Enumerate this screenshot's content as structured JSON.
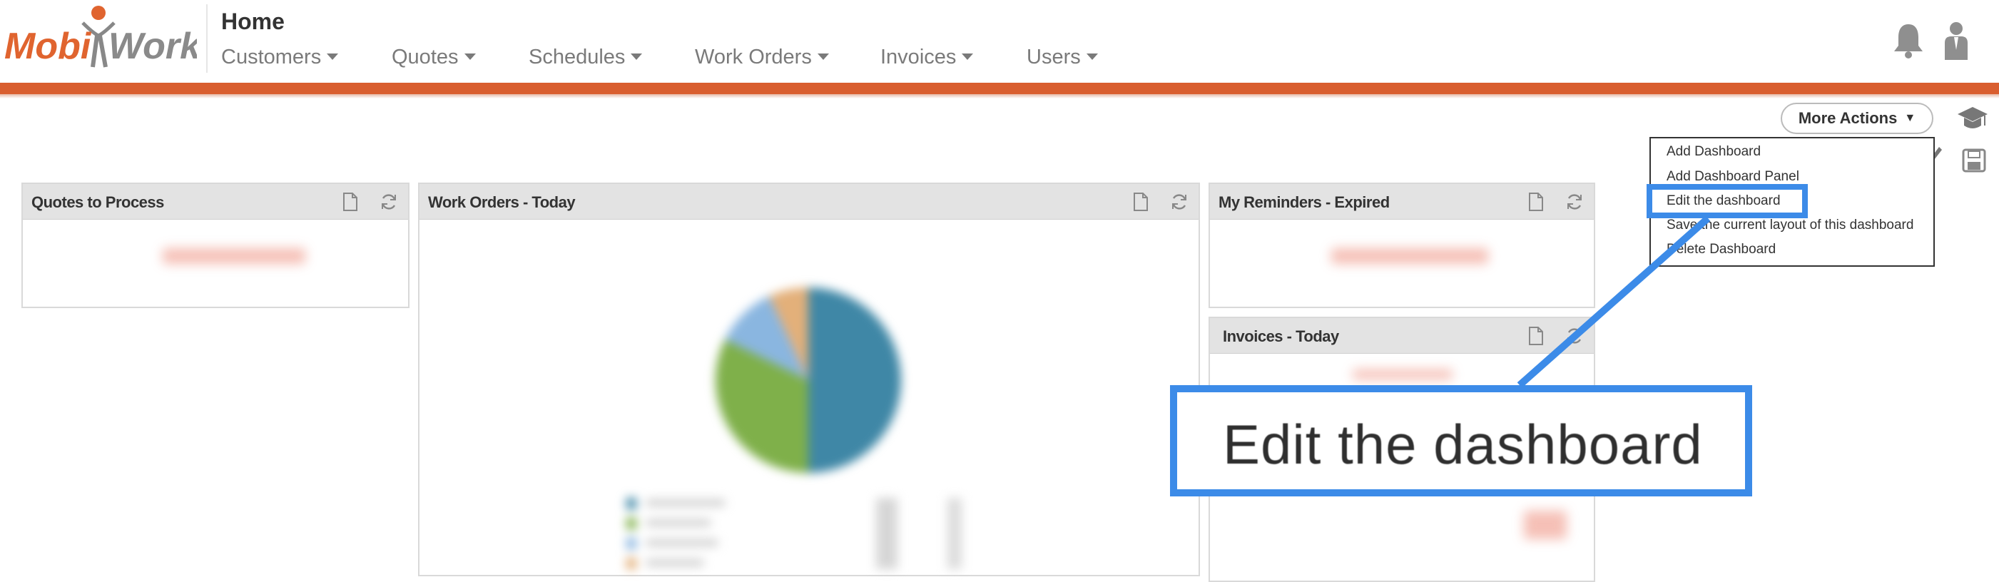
{
  "app": {
    "logo_text_left": "Mobi",
    "logo_text_right": "Work",
    "page_title": "Home"
  },
  "nav": {
    "items": [
      {
        "label": "Customers"
      },
      {
        "label": "Quotes"
      },
      {
        "label": "Schedules"
      },
      {
        "label": "Work Orders"
      },
      {
        "label": "Invoices"
      },
      {
        "label": "Users"
      }
    ]
  },
  "header_icons": {
    "notifications": "bell-icon",
    "user": "user-icon"
  },
  "toolbar": {
    "more_actions_label": "More Actions",
    "more_actions_caret": "▼",
    "help_icon": "graduation-cap-icon",
    "edit_icon": "pencil-icon",
    "save_icon": "save-icon"
  },
  "dropdown": {
    "items": [
      {
        "label": "Add Dashboard"
      },
      {
        "label": "Add Dashboard Panel"
      },
      {
        "label": "Edit the dashboard"
      },
      {
        "label": "Save the current layout of this dashboard"
      },
      {
        "label": "Delete Dashboard"
      }
    ]
  },
  "panels": [
    {
      "title": "Quotes to Process"
    },
    {
      "title": "Work Orders - Today"
    },
    {
      "title": "My Reminders - Expired"
    },
    {
      "title": "Invoices - Today"
    }
  ],
  "callout": {
    "text": "Edit the dashboard",
    "accent": "#3c8be8"
  },
  "colors": {
    "brand_orange": "#d95e2f",
    "pie_blue": "#3f87a6",
    "pie_green": "#7fb04a",
    "pie_lightblue": "#8ab6e0",
    "pie_tan": "#e3b07a"
  }
}
